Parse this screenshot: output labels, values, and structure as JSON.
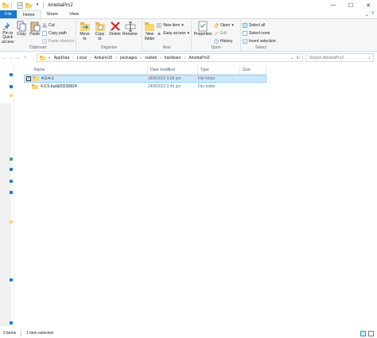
{
  "window": {
    "title": "AmebaPro2",
    "controls": [
      "—",
      "☐",
      "✕"
    ]
  },
  "tabs": {
    "file": "File",
    "home": "Home",
    "share": "Share",
    "view": "View"
  },
  "ribbon": {
    "clipboard": {
      "label": "Clipboard",
      "pin": "Pin to Quick access",
      "copy": "Copy",
      "paste": "Paste",
      "cut": "Cut",
      "copy_path": "Copy path",
      "paste_shortcut": "Paste shortcut"
    },
    "organize": {
      "label": "Organize",
      "move_to": "Move to",
      "copy_to": "Copy to",
      "delete": "Delete",
      "rename": "Rename"
    },
    "new": {
      "label": "New",
      "new_folder": "New folder",
      "new_item": "New item",
      "easy_access": "Easy access"
    },
    "open": {
      "label": "Open",
      "properties": "Properties",
      "open": "Open",
      "edit": "Edit",
      "history": "History"
    },
    "select": {
      "label": "Select",
      "select_all": "Select all",
      "select_none": "Select none",
      "invert": "Invert selection"
    }
  },
  "address": {
    "crumbs": [
      "AppData",
      "Local",
      "Arduino15",
      "packages",
      "realtek",
      "hardware",
      "AmebaPro2"
    ],
    "search_placeholder": "Search AmebaPro2"
  },
  "columns": {
    "name": "Name",
    "date": "Date modified",
    "type": "Type",
    "size": "Size"
  },
  "files": [
    {
      "name": "4.0.4-1",
      "date": "28/8/2023 9:08 pm",
      "type": "File folder",
      "size": "",
      "selected": true
    },
    {
      "name": "4.0.5-build20230824",
      "date": "24/8/2023 2:45 pm",
      "type": "File folder",
      "size": "",
      "selected": false
    }
  ],
  "status": {
    "count": "2 items",
    "selected": "1 item selected"
  },
  "colors": {
    "accent": "#1979ca",
    "selection": "#cce8ff",
    "folder": "#f8d775"
  }
}
